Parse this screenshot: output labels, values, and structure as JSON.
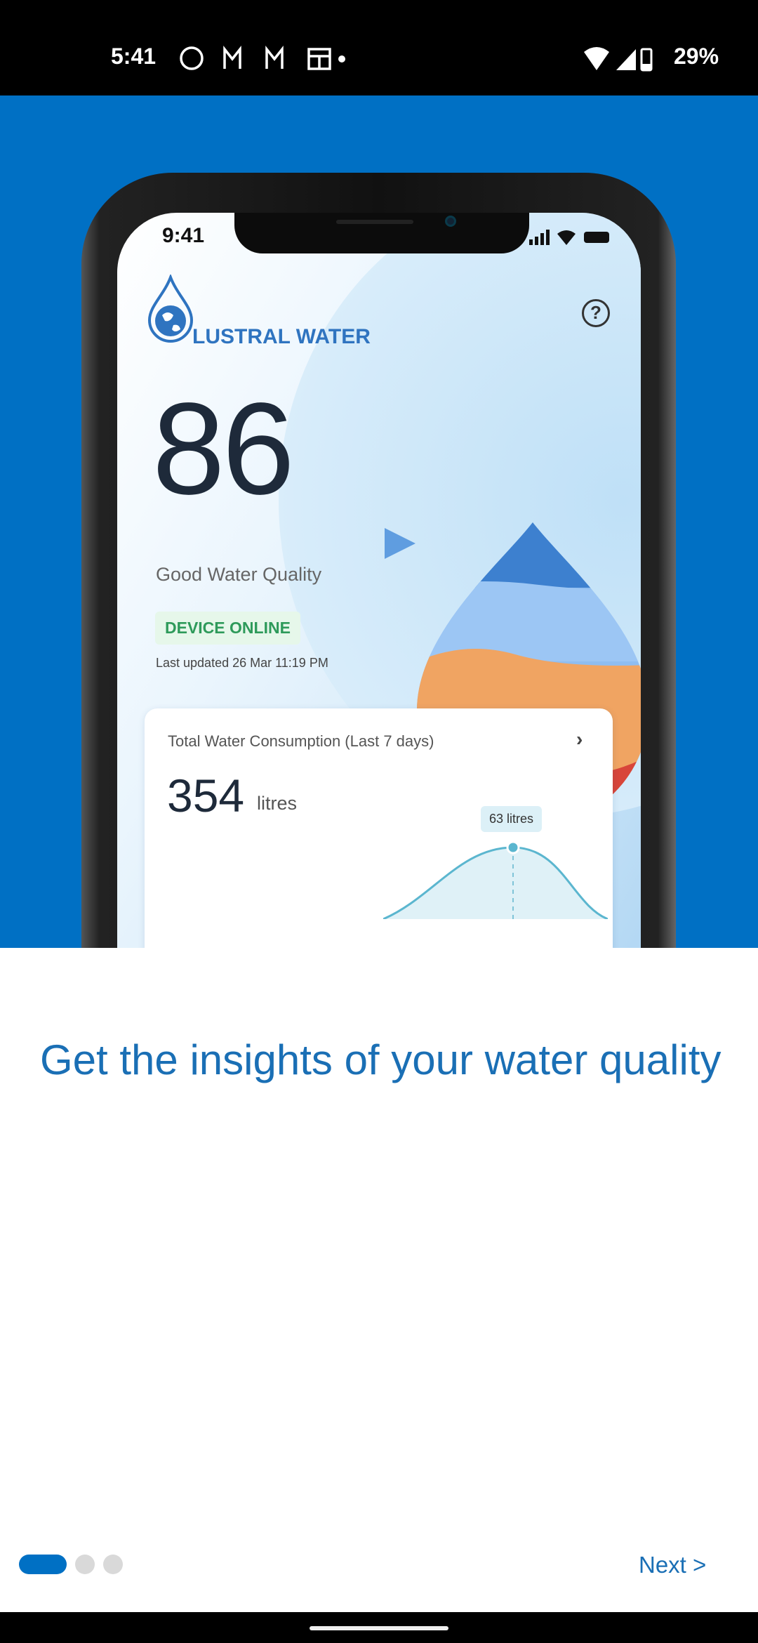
{
  "status_bar": {
    "time": "5:41",
    "battery": "29%",
    "icons": [
      "whatsapp-icon",
      "gmail-icon",
      "gmail-icon",
      "calendar-icon",
      "dot-icon",
      "wifi-icon",
      "signal-icon",
      "battery-icon"
    ]
  },
  "mockup": {
    "time": "9:41",
    "brand": "LUSTRAL WATER",
    "score": "86",
    "quality_label": "Good Water Quality",
    "device_status": "DEVICE ONLINE",
    "last_updated": "Last updated 26 Mar 11:19 PM",
    "card": {
      "title": "Total Water Consumption (Last 7 days)",
      "total": "354",
      "unit": "litres",
      "tooltip": "63 litres"
    }
  },
  "onboarding": {
    "title": "Get the insights of your water quality",
    "next_label": "Next >",
    "pages": 3,
    "current_page": 1
  },
  "colors": {
    "brand_blue": "#0070c4",
    "title": "#1a6fb5",
    "online_green": "#2e9a5a"
  }
}
